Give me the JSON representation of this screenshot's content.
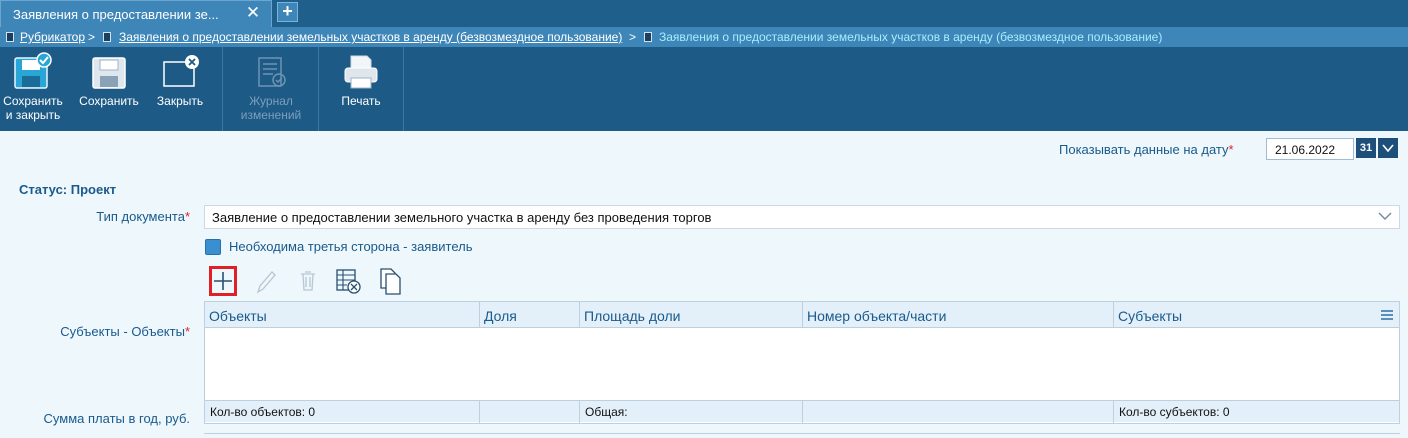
{
  "tab": {
    "title": "Заявления о предоставлении зе...",
    "close_glyph": "✕",
    "add_glyph": "+"
  },
  "breadcrumb": {
    "root": "Рубрикатор",
    "sep": ">",
    "level1": "Заявления о предоставлении земельных участков в аренду (безвозмездное пользование)",
    "current": "Заявления о предоставлении земельных участков в аренду (безвозмездное пользование)"
  },
  "toolbar": {
    "save_close_1": "Сохранить",
    "save_close_2": "и закрыть",
    "save": "Сохранить",
    "close": "Закрыть",
    "journal_1": "Журнал",
    "journal_2": "изменений",
    "print": "Печать"
  },
  "date_filter": {
    "label": "Показывать данные на дату",
    "required_mark": "*",
    "value": "21.06.2022",
    "calendar_glyph": "31"
  },
  "status": "Статус: Проект",
  "doc_type": {
    "label": "Тип документа",
    "required_mark": "*",
    "value": "Заявление о предоставлении земельного участка в аренду без проведения торгов"
  },
  "third_party": {
    "label": "Необходима третья сторона - заявитель"
  },
  "subjects_objects": {
    "label": "Субъекты - Объекты",
    "required_mark": "*",
    "columns": [
      "Объекты",
      "Доля",
      "Площадь доли",
      "Номер объекта/части",
      "Субъекты"
    ],
    "footer": [
      "Кол-во объектов: 0",
      "",
      "Общая:",
      "",
      "Кол-во субъектов: 0"
    ]
  },
  "payment_label": "Сумма платы в год, руб.",
  "colors": {
    "header_bg": "#1f5f8b",
    "toolbar_bg": "#1e5a86",
    "accent": "#3f86b8",
    "highlight": "#e02027"
  }
}
